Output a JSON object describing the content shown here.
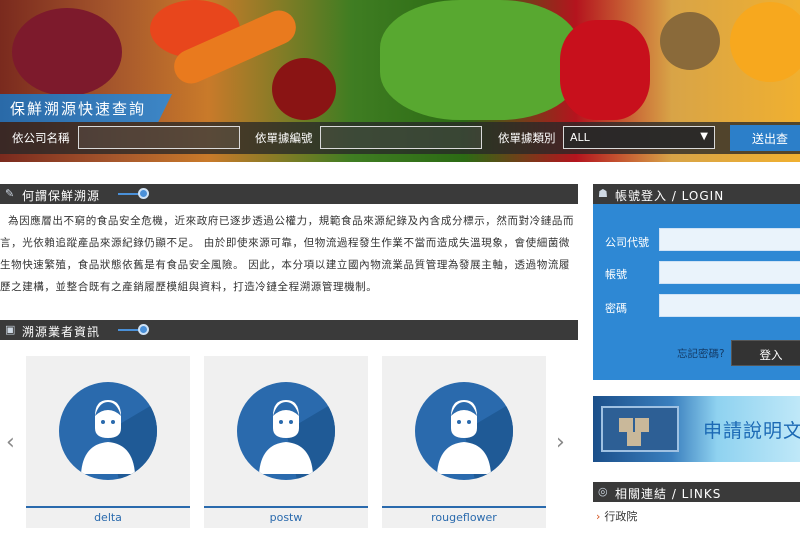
{
  "banner": {
    "title": "保鮮溯源快速查詢",
    "company_label": "依公司名稱",
    "company_value": "",
    "order_label": "依單據編號",
    "order_value": "",
    "type_label": "依單據類別",
    "type_selected": "ALL",
    "submit_label": "送出查"
  },
  "about": {
    "heading": "何謂保鮮溯源",
    "body": "為因應層出不窮的食品安全危機，近來政府已逐步透過公權力，規範食品來源紀錄及內含成分標示，然而對冷鏈品而言，光依賴追蹤產品來源紀錄仍顯不足。 由於即使來源可靠，但物流過程發生作業不當而造成失溫現象，會使細菌微生物快速繁殖，食品狀態依舊是有食品安全風險。 因此，本分項以建立國內物流業品質管理為發展主軸，透過物流履歷之建構，並整合既有之產銷履歷模組與資料，打造冷鏈全程溯源管理機制。"
  },
  "vendors": {
    "heading": "溯源業者資訊",
    "items": [
      {
        "name": "delta"
      },
      {
        "name": "postw"
      },
      {
        "name": "rougeflower"
      }
    ]
  },
  "login": {
    "heading": "帳號登入 / LOGIN",
    "company_code_label": "公司代號",
    "account_label": "帳號",
    "password_label": "密碼",
    "forgot_label": "忘記密碼?",
    "submit_label": "登入"
  },
  "ad": {
    "text": "申請說明文"
  },
  "links": {
    "heading": "相關連結 / LINKS",
    "items": [
      {
        "label": "行政院"
      }
    ]
  },
  "colors": {
    "accent": "#2e88d4",
    "dark_bar": "#3a3a3a",
    "card_blue": "#2a6aad"
  }
}
